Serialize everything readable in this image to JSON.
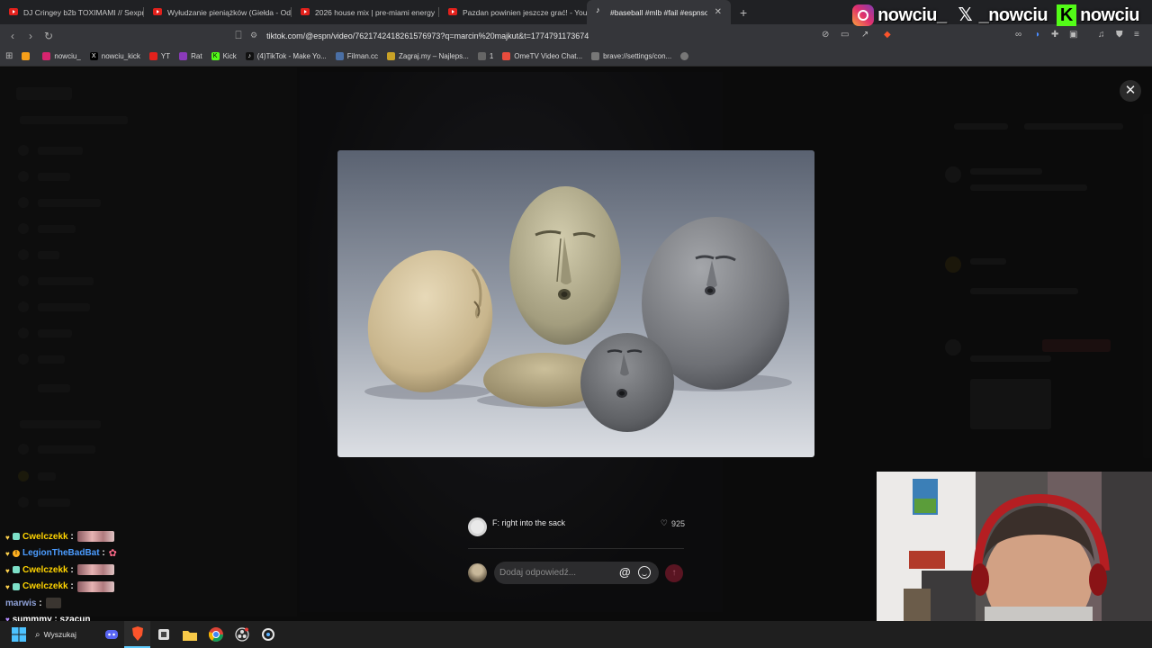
{
  "browser": {
    "tabs": [
      {
        "title": "DJ Cringey b2b TOXIMAMI // Sexpre",
        "width": 160
      },
      {
        "title": "Wyłudzanie pieniążków (Giełda - Od",
        "width": 164
      },
      {
        "title": "2026 house mix | pre-miami energy",
        "width": 164
      },
      {
        "title": "Pazdan powinien jeszcze grać! - YouT",
        "width": 164
      },
      {
        "title": "#baseball #mlb #fail #espnsocial",
        "width": 160
      }
    ],
    "url": "tiktok.com/@espn/video/7621742418261576973?q=marcin%20majkut&t=1774791173674",
    "bookmarks": [
      {
        "label": "",
        "color": "#f59f1a"
      },
      {
        "label": "nowciu_",
        "color": "#d6246e"
      },
      {
        "label": "nowciu_kick",
        "color": "#000000"
      },
      {
        "label": "YT",
        "color": "#e2211c"
      },
      {
        "label": "Rat",
        "color": "#8a3ab9"
      },
      {
        "label": "Kick",
        "color": "#53fc18"
      },
      {
        "label": "(4)TikTok - Make Yo...",
        "color": "#111111"
      },
      {
        "label": "Filman.cc",
        "color": "#4a6fa5"
      },
      {
        "label": "Zagraj.my – Najleps...",
        "color": "#c9a227"
      },
      {
        "label": "1",
        "color": "#666666"
      },
      {
        "label": "OmeTV Video Chat...",
        "color": "#e84c3d"
      },
      {
        "label": "brave://settings/con...",
        "color": "#777777"
      },
      {
        "label": "",
        "color": "#777777"
      }
    ]
  },
  "overlay": {
    "instagram": "nowciu_",
    "x": "_nowciu",
    "kick": "nowciu"
  },
  "comment": {
    "text": "F: right into the sack",
    "likes": "925"
  },
  "reply": {
    "placeholder": "Dodaj odpowiedź..."
  },
  "chat": [
    {
      "user": "Cwelczekk",
      "color": "#ffd400",
      "badges": true,
      "msg": "",
      "img": true
    },
    {
      "user": "LegionTheBadBat",
      "color": "#4b9cff",
      "badges": true,
      "msg": "",
      "octo": true
    },
    {
      "user": "Cwelczekk",
      "color": "#ffd400",
      "badges": true,
      "msg": "",
      "img": true
    },
    {
      "user": "Cwelczekk",
      "color": "#ffd400",
      "badges": true,
      "msg": "",
      "img": true
    },
    {
      "user": "marwis",
      "color": "#8ea0d6",
      "badges": false,
      "msg": "",
      "tiny": true
    },
    {
      "user": "summmy",
      "color": "#ffffff",
      "badges": false,
      "msg": "szacun",
      "heart": true
    }
  ],
  "taskbar": {
    "search_label": "Wyszukaj"
  }
}
